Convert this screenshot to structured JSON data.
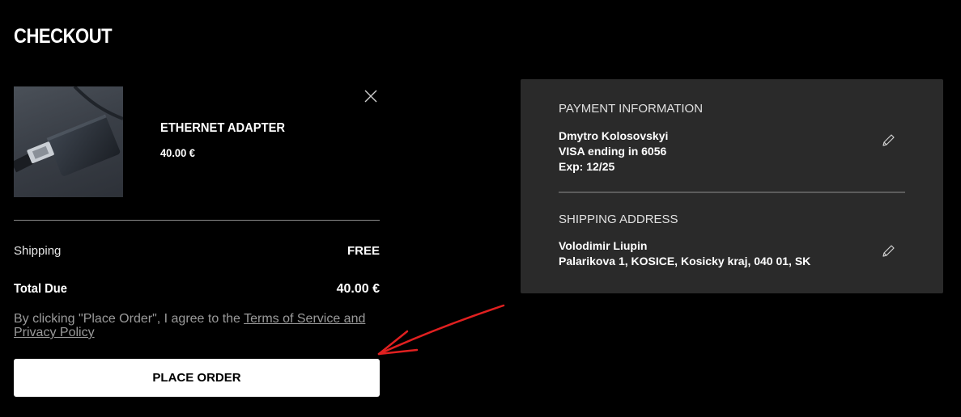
{
  "page": {
    "title": "CHECKOUT"
  },
  "cart": {
    "item": {
      "name": "ETHERNET ADAPTER",
      "price": "40.00 €",
      "image_icon": "ethernet-adapter-image",
      "remove_icon": "close-icon"
    }
  },
  "summary": {
    "shipping_label": "Shipping",
    "shipping_value": "FREE",
    "total_label": "Total Due",
    "total_value": "40.00 €"
  },
  "agreement": {
    "prefix": "By clicking \"Place Order\", I agree to the ",
    "link_text": "Terms of Service and Privacy Policy"
  },
  "actions": {
    "place_order_label": "PLACE ORDER"
  },
  "payment": {
    "title": "PAYMENT INFORMATION",
    "name": "Dmytro Kolosovskyi",
    "card": "VISA ending in 6056",
    "expiry": "Exp: 12/25",
    "edit_icon": "pencil-icon"
  },
  "shipping": {
    "title": "SHIPPING ADDRESS",
    "name": "Volodimir Liupin",
    "address": "Palarikova 1, KOSICE, Kosicky kraj, 040 01, SK",
    "edit_icon": "pencil-icon"
  },
  "annotation": {
    "icon": "red-arrow-annotation",
    "color": "#e02020"
  },
  "colors": {
    "background": "#000000",
    "panel": "#2a2a2a",
    "button": "#ffffff",
    "muted_text": "#9a9a9a"
  }
}
